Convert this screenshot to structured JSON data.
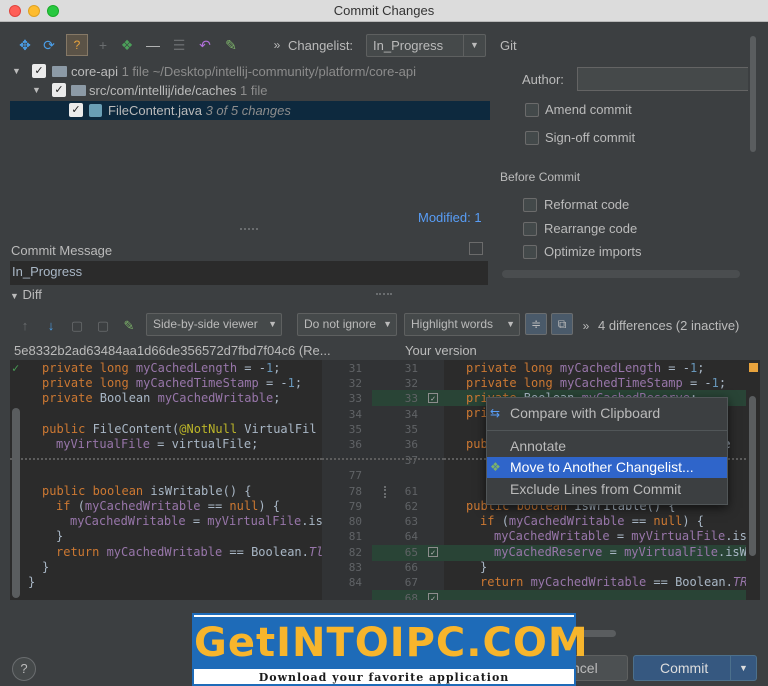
{
  "window": {
    "title": "Commit Changes"
  },
  "toolbar": {
    "changelist_label": "Changelist:",
    "changelist_value": "In_Progress",
    "icons": [
      "move-icon",
      "refresh-icon",
      "show-diff-icon",
      "add-icon",
      "group-icon",
      "remove-icon",
      "collapse-icon",
      "revert-icon",
      "edit-icon",
      "more-icon"
    ]
  },
  "tree": {
    "rows": [
      {
        "name": "core-api",
        "meta": "1 file",
        "path": "~/Desktop/intellij-community/platform/core-api"
      },
      {
        "name": "src/com/intellij/ide/caches",
        "meta": "1 file"
      },
      {
        "name": "FileContent.java",
        "meta": "3 of 5 changes"
      }
    ],
    "modified_link": "Modified: 1"
  },
  "git": {
    "section": "Git",
    "author_label": "Author:",
    "author_value": "",
    "amend": "Amend commit",
    "signoff": "Sign-off commit",
    "before_commit": "Before Commit",
    "reformat": "Reformat code",
    "rearrange": "Rearrange code",
    "optimize": "Optimize imports"
  },
  "commit_message": {
    "label": "Commit Message",
    "value": "In_Progress"
  },
  "diff": {
    "label": "Diff",
    "viewer": "Side-by-side viewer",
    "ignore": "Do not ignore",
    "highlight": "Highlight words",
    "summary": "4 differences (2 inactive)",
    "left_revision": "5e8332b2ad63484aa1d66de356572d7fbd7f04c6 (Re...",
    "right_revision": "Your version",
    "left_numbers": [
      "31",
      "32",
      "33",
      "34",
      "35",
      "36",
      "",
      "77",
      "78",
      "79",
      "80",
      "81",
      "82",
      "83",
      "84"
    ],
    "right_numbers": [
      "31",
      "32",
      "33",
      "34",
      "35",
      "36",
      "37",
      "",
      "61",
      "62",
      "63",
      "64",
      "65",
      "66",
      "67",
      "68"
    ]
  },
  "context_menu": {
    "items": [
      "Compare with Clipboard",
      "Annotate",
      "Move to Another Changelist...",
      "Exclude Lines from Commit"
    ]
  },
  "buttons": {
    "help": "?",
    "cancel": "ncel",
    "commit": "Commit"
  },
  "banner": {
    "title": "GetINTOIPC.COM",
    "subtitle": "Download your favorite application"
  }
}
